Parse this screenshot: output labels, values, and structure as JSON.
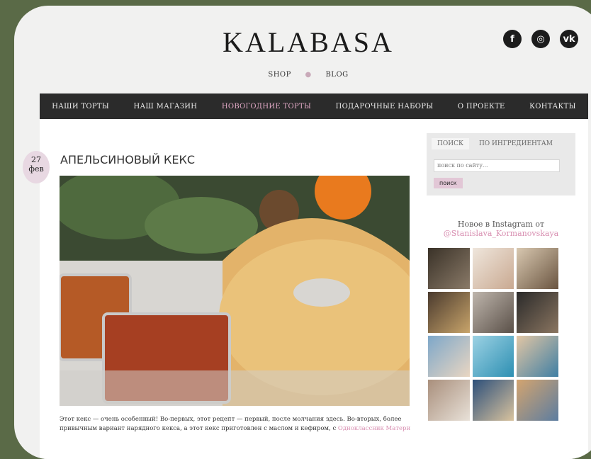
{
  "brand": {
    "logo_text": "KALABASA"
  },
  "social_icons": [
    {
      "icon": "facebook-icon",
      "glyph": "f"
    },
    {
      "icon": "instagram-icon",
      "glyph": "◎"
    },
    {
      "icon": "vk-icon",
      "glyph": "vk"
    }
  ],
  "subnav": {
    "shop": "SHOP",
    "blog": "BLOG"
  },
  "mainnav": {
    "items": [
      "НАШИ ТОРТЫ",
      "НАШ МАГАЗИН",
      "НОВОГОДНИЕ ТОРТЫ",
      "ПОДАРОЧНЫЕ НАБОРЫ",
      "О ПРОЕКТЕ",
      "КОНТАКТЫ"
    ],
    "active_index": 2
  },
  "post": {
    "date_day": "27",
    "date_month": "фев",
    "title": "АПЕЛЬСИНОВЫЙ КЕКС",
    "text": "Этот кекс — очень особенный! Во-первых, этот рецепт — первый, после молчания здесь. Во-вторых, более",
    "text_line2": "привычным вариант нарядного кекса, а этот кекс приготовлен с маслом и кефиром, с",
    "text_link": "Одноклассник Матери"
  },
  "sidebar": {
    "tab_search": "ПОИСК",
    "tab_ingredients": "ПО ИНГРЕДИЕНТАМ",
    "search_placeholder": "поиск по сайту...",
    "search_button": "поиск",
    "insta_heading": "Новое в Instagram от",
    "insta_handle": "@Stanislava_Kormanovskaya"
  },
  "colors": {
    "accent": "#e2a9c6",
    "nav_bg": "#2b2b2b",
    "page_bg": "#5a6a47"
  }
}
